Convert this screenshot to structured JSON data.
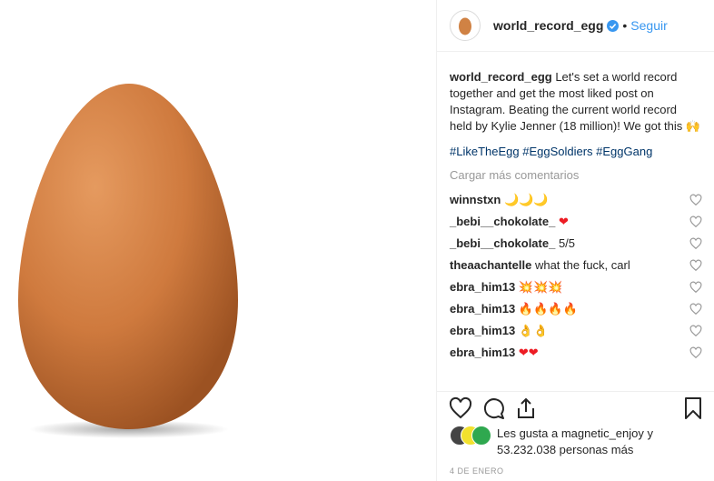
{
  "post": {
    "username": "world_record_egg",
    "separator": "•",
    "follow_label": "Seguir",
    "caption_user": "world_record_egg",
    "caption_text": "Let's set a world record together and get the most liked post on Instagram. Beating the current world record held by Kylie Jenner (18 million)! We got this 🙌",
    "hashtags": "#LikeTheEgg #EggSoldiers #EggGang",
    "load_more": "Cargar más comentarios",
    "comments": [
      {
        "user": "winnstxn",
        "text": "🌙🌙🌙"
      },
      {
        "user": "_bebi__chokolate_",
        "text": "❤"
      },
      {
        "user": "_bebi__chokolate_",
        "text": "5/5"
      },
      {
        "user": "theaachantelle",
        "text": "what the fuck, carl"
      },
      {
        "user": "ebra_him13",
        "text": "💥💥💥"
      },
      {
        "user": "ebra_him13",
        "text": "🔥🔥🔥🔥"
      },
      {
        "user": "ebra_him13",
        "text": "👌👌"
      },
      {
        "user": "ebra_him13",
        "text": "❤❤"
      }
    ],
    "likes_text": "Les gusta a magnetic_enjoy y 53.232.038 personas más",
    "date": "4 DE ENERO"
  },
  "colors": {
    "accent": "#3897f0",
    "hashtag": "#003569",
    "muted": "#999999",
    "verified": "#3897f0"
  },
  "icons": {
    "like": "heart-outline-icon",
    "comment": "comment-bubble-icon",
    "share": "share-icon",
    "save": "bookmark-icon"
  }
}
